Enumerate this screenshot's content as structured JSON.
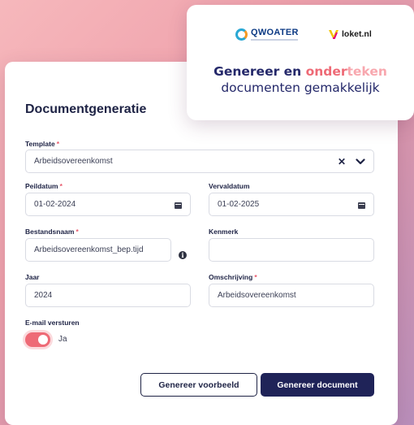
{
  "brand": {
    "qwoater_name": "QWOATER",
    "loket_name": "loket.nl",
    "headline_part1": "Genereer en ",
    "headline_part2": "onder",
    "headline_part3": "teken",
    "headline_line2": "documenten gemakkelijk",
    "colors": {
      "navy": "#24286a",
      "coral": "#ee6a76",
      "light_coral": "#f8a7ae"
    }
  },
  "form": {
    "title": "Documentgeneratie",
    "template": {
      "label": "Template",
      "value": "Arbeidsovereenkomst",
      "required": true
    },
    "peildatum": {
      "label": "Peildatum",
      "value": "01-02-2024",
      "required": true
    },
    "vervaldatum": {
      "label": "Vervaldatum",
      "value": "01-02-2025",
      "required": false
    },
    "bestandsnaam": {
      "label": "Bestandsnaam",
      "value": "Arbeidsovereenkomst_bep.tijd",
      "required": true
    },
    "kenmerk": {
      "label": "Kenmerk",
      "value": "",
      "required": false
    },
    "jaar": {
      "label": "Jaar",
      "value": "2024",
      "required": false
    },
    "omschrijving": {
      "label": "Omschrijving",
      "value": "Arbeidsovereenkomst",
      "required": true
    },
    "email": {
      "label": "E-mail versturen",
      "toggle_label": "Ja",
      "enabled": true
    },
    "required_marker": "*",
    "buttons": {
      "preview": "Genereer voorbeeld",
      "generate": "Genereer document"
    }
  },
  "icons": {
    "calendar": "calendar-icon",
    "clear": "close-icon",
    "dropdown": "chevron-down-icon",
    "info": "info-icon"
  }
}
